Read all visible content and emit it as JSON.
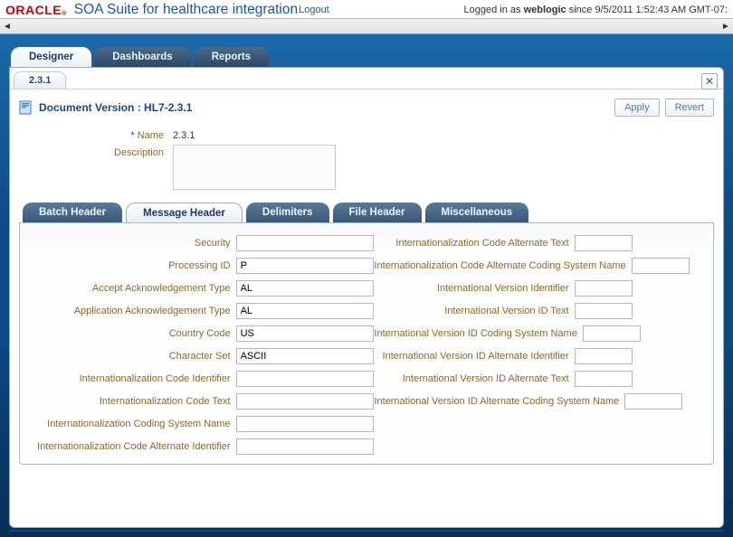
{
  "header": {
    "brand_prefix": "ORACLE",
    "suite_title": "SOA Suite for healthcare integration",
    "logout_label": "Logout",
    "status_prefix": "Logged in as ",
    "status_user": "weblogic",
    "status_middle": " since ",
    "status_time": "9/5/2011 1:52:43 AM GMT-07:"
  },
  "nav_tabs": {
    "designer": "Designer",
    "dashboards": "Dashboards",
    "reports": "Reports"
  },
  "subtab_label": "2.3.1",
  "doc_title": "Document Version : HL7-2.3.1",
  "buttons": {
    "apply": "Apply",
    "revert": "Revert"
  },
  "name_label": "* Name",
  "name_value": "2.3.1",
  "desc_label": "Description",
  "inner_tabs": {
    "batch": "Batch Header",
    "message": "Message Header",
    "delim": "Delimiters",
    "file": "File Header",
    "misc": "Miscellaneous"
  },
  "left_fields": [
    {
      "label": "Security",
      "value": ""
    },
    {
      "label": "Processing ID",
      "value": "P"
    },
    {
      "label": "Accept Acknowledgement Type",
      "value": "AL"
    },
    {
      "label": "Application Acknowledgement Type",
      "value": "AL"
    },
    {
      "label": "Country Code",
      "value": "US"
    },
    {
      "label": "Character Set",
      "value": "ASCII"
    },
    {
      "label": "Internationalization Code Identifier",
      "value": ""
    },
    {
      "label": "Internationalization Code Text",
      "value": ""
    },
    {
      "label": "Internationalization Coding System Name",
      "value": ""
    },
    {
      "label": "Internationalization Code Alternate Identifier",
      "value": ""
    }
  ],
  "right_fields": [
    {
      "label": "Internationalization Code Alternate Text",
      "value": ""
    },
    {
      "label": "Internationalization Code Alternate Coding System Name",
      "value": ""
    },
    {
      "label": "International Version Identifier",
      "value": ""
    },
    {
      "label": "International Version ID Text",
      "value": ""
    },
    {
      "label": "International Version ID Coding System Name",
      "value": ""
    },
    {
      "label": "International Version ID Alternate Identifier",
      "value": ""
    },
    {
      "label": "International Version ID Alternate Text",
      "value": ""
    },
    {
      "label": "International Version ID Alternate Coding System Name",
      "value": ""
    }
  ]
}
